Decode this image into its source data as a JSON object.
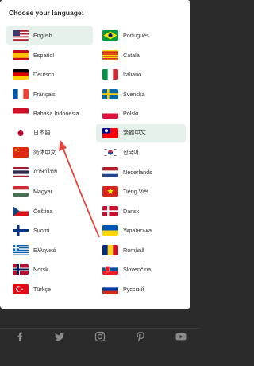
{
  "title": "Choose your language:",
  "languages": [
    {
      "label": "English",
      "flag": "us"
    },
    {
      "label": "Português",
      "flag": "br"
    },
    {
      "label": "Español",
      "flag": "es"
    },
    {
      "label": "Català",
      "flag": "ct"
    },
    {
      "label": "Deutsch",
      "flag": "de"
    },
    {
      "label": "Italiano",
      "flag": "it"
    },
    {
      "label": "Français",
      "flag": "fr"
    },
    {
      "label": "Svenska",
      "flag": "se"
    },
    {
      "label": "Bahasa Indonesia",
      "flag": "id"
    },
    {
      "label": "Polski",
      "flag": "pl"
    },
    {
      "label": "日本語",
      "flag": "jp"
    },
    {
      "label": "繁體中文",
      "flag": "tw"
    },
    {
      "label": "简体中文",
      "flag": "cn"
    },
    {
      "label": "한국어",
      "flag": "kr"
    },
    {
      "label": "ภาษาไทย",
      "flag": "th"
    },
    {
      "label": "Nederlands",
      "flag": "nl"
    },
    {
      "label": "Magyar",
      "flag": "hu"
    },
    {
      "label": "Tiếng Việt",
      "flag": "vn"
    },
    {
      "label": "Čeština",
      "flag": "cz"
    },
    {
      "label": "Dansk",
      "flag": "dk"
    },
    {
      "label": "Suomi",
      "flag": "fi"
    },
    {
      "label": "Українська",
      "flag": "ua"
    },
    {
      "label": "Ελληνικά",
      "flag": "gr"
    },
    {
      "label": "Română",
      "flag": "ro"
    },
    {
      "label": "Norsk",
      "flag": "no"
    },
    {
      "label": "Slovenčina",
      "flag": "sk"
    },
    {
      "label": "Türkçe",
      "flag": "tr"
    },
    {
      "label": "Русский",
      "flag": "ru"
    }
  ],
  "selected_language": "English",
  "highlighted_language": "繁體中文",
  "social_icons": [
    "facebook-icon",
    "twitter-icon",
    "instagram-icon",
    "pinterest-icon",
    "youtube-icon"
  ],
  "colors": {
    "selected_bg": "#e7f1ec",
    "annotation_arrow": "#e8443a",
    "footer_bg": "#2b2b2b"
  }
}
